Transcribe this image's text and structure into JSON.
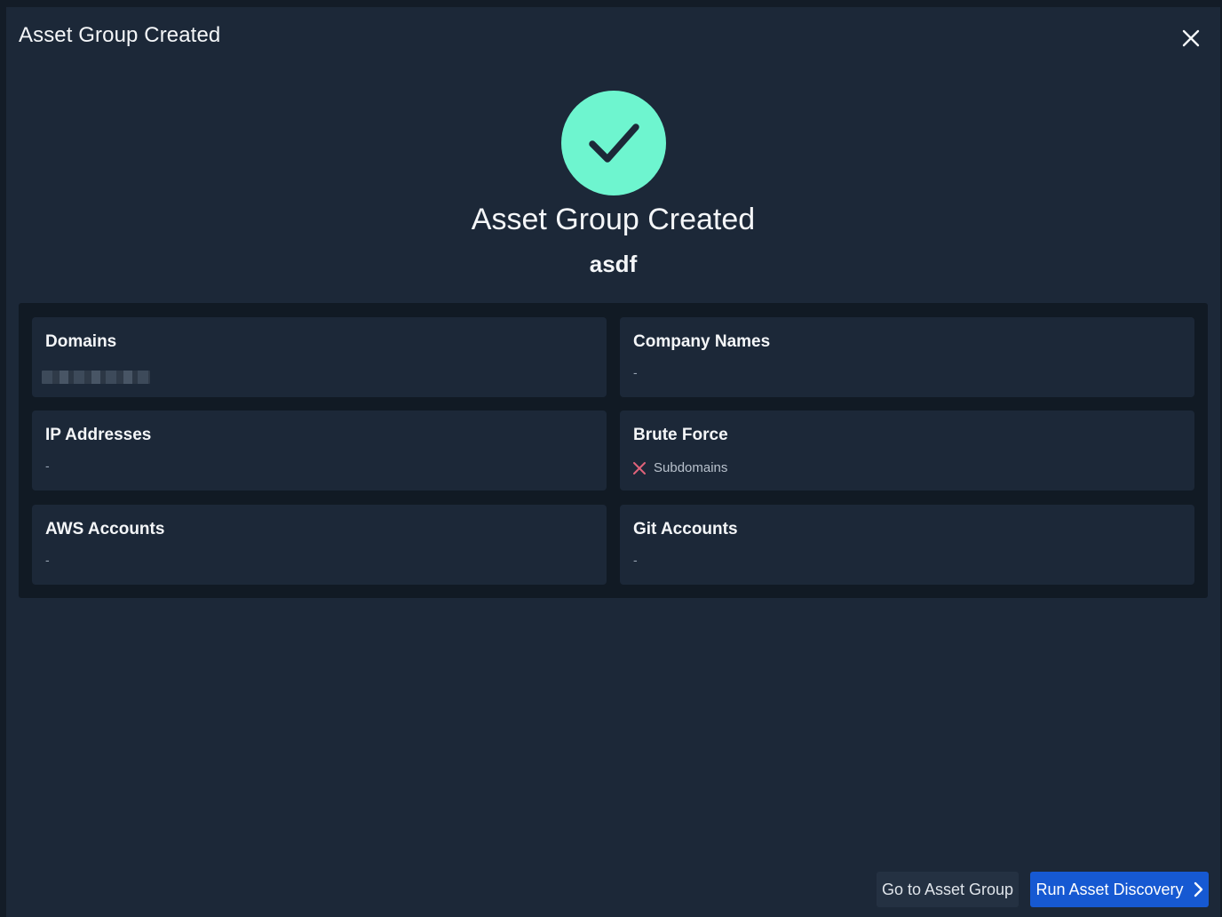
{
  "dialog": {
    "title": "Asset Group Created",
    "close_icon": "close-icon"
  },
  "hero": {
    "icon": "checkmark-icon",
    "icon_bg_color": "#6ef5cf",
    "title": "Asset Group Created",
    "group_name": "asdf"
  },
  "summary": {
    "domains": {
      "label": "Domains",
      "value": ""
    },
    "company_names": {
      "label": "Company Names",
      "value": "-"
    },
    "ip_addresses": {
      "label": "IP Addresses",
      "value": "-"
    },
    "brute_force": {
      "label": "Brute Force",
      "items": [
        {
          "icon": "x-icon",
          "label": "Subdomains",
          "enabled": false
        }
      ]
    },
    "aws_accounts": {
      "label": "AWS Accounts",
      "value": "-"
    },
    "git_accounts": {
      "label": "Git Accounts",
      "value": "-"
    }
  },
  "actions": {
    "secondary_label": "Go to Asset Group",
    "primary_label": "Run Asset Discovery",
    "primary_icon": "chevron-right-icon",
    "primary_color": "#1659d2"
  }
}
